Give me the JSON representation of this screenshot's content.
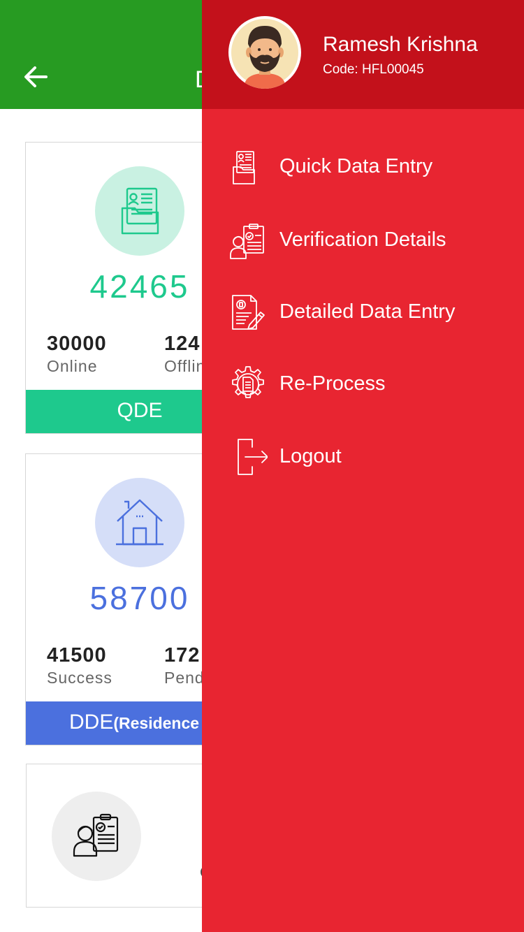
{
  "appbar": {
    "title": "D",
    "back_icon": "arrow-left-icon",
    "background": "#279b22"
  },
  "cards": {
    "qde": {
      "icon": "folder-document-icon",
      "total": "42465",
      "stat1_value": "30000",
      "stat1_label": "Online",
      "stat2_value": "124",
      "stat2_label": "Offlin",
      "footer_label": "QDE",
      "accent": "#1ec98d"
    },
    "dde": {
      "icon": "house-icon",
      "total": "58700",
      "stat1_value": "41500",
      "stat1_label": "Success",
      "stat2_value": "172",
      "stat2_label": "Pend",
      "footer_label_main": "DDE",
      "footer_label_sub": "(Residence",
      "accent": "#4b70de"
    },
    "verification": {
      "icon": "verification-person-icon",
      "partial_text": "C"
    }
  },
  "drawer": {
    "header_background": "#c3111b",
    "background": "#e82531",
    "user": {
      "name": "Ramesh Krishna",
      "code": "Code: HFL00045",
      "avatar_icon": "bearded-man-avatar"
    },
    "menu": [
      {
        "label": "Quick Data Entry",
        "icon": "folder-document-icon"
      },
      {
        "label": "Verification Details",
        "icon": "verification-person-icon"
      },
      {
        "label": "Detailed Data Entry",
        "icon": "document-pencil-icon"
      },
      {
        "label": "Re-Process",
        "icon": "gear-document-icon"
      },
      {
        "label": "Logout",
        "icon": "logout-icon"
      }
    ]
  }
}
